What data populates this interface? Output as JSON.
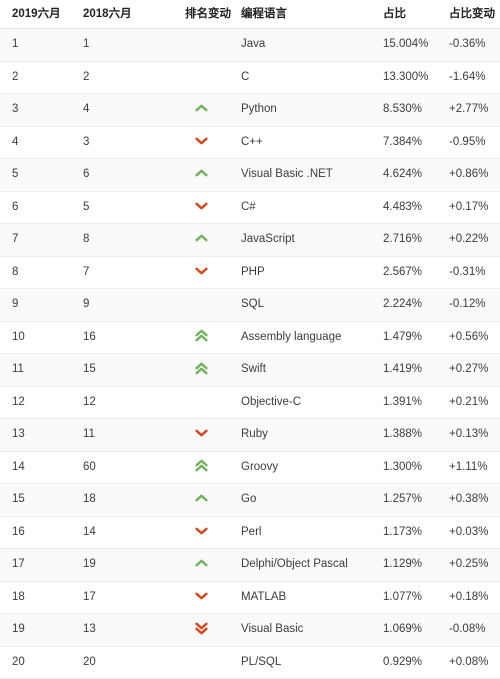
{
  "table": {
    "headers": {
      "rank_new": "2019六月",
      "rank_old": "2018六月",
      "change": "排名变动",
      "language": "编程语言",
      "share": "占比",
      "share_change": "占比变动"
    },
    "colors": {
      "up": "#72b25e",
      "down": "#d8461c",
      "text": "#3c3c3c",
      "header_text": "#222222",
      "row_odd": "#fafafa",
      "row_even": "#ffffff",
      "row_border": "#ededed",
      "header_border": "#e2e2e2"
    },
    "rows": [
      {
        "rank_new": "1",
        "rank_old": "1",
        "trend": "none",
        "language": "Java",
        "share": "15.004%",
        "share_change": "-0.36%"
      },
      {
        "rank_new": "2",
        "rank_old": "2",
        "trend": "none",
        "language": "C",
        "share": "13.300%",
        "share_change": "-1.64%"
      },
      {
        "rank_new": "3",
        "rank_old": "4",
        "trend": "up",
        "language": "Python",
        "share": "8.530%",
        "share_change": "+2.77%"
      },
      {
        "rank_new": "4",
        "rank_old": "3",
        "trend": "down",
        "language": "C++",
        "share": "7.384%",
        "share_change": "-0.95%"
      },
      {
        "rank_new": "5",
        "rank_old": "6",
        "trend": "up",
        "language": "Visual Basic .NET",
        "share": "4.624%",
        "share_change": "+0.86%"
      },
      {
        "rank_new": "6",
        "rank_old": "5",
        "trend": "down",
        "language": "C#",
        "share": "4.483%",
        "share_change": "+0.17%"
      },
      {
        "rank_new": "7",
        "rank_old": "8",
        "trend": "up",
        "language": "JavaScript",
        "share": "2.716%",
        "share_change": "+0.22%"
      },
      {
        "rank_new": "8",
        "rank_old": "7",
        "trend": "down",
        "language": "PHP",
        "share": "2.567%",
        "share_change": "-0.31%"
      },
      {
        "rank_new": "9",
        "rank_old": "9",
        "trend": "none",
        "language": "SQL",
        "share": "2.224%",
        "share_change": "-0.12%"
      },
      {
        "rank_new": "10",
        "rank_old": "16",
        "trend": "up-double",
        "language": "Assembly language",
        "share": "1.479%",
        "share_change": "+0.56%"
      },
      {
        "rank_new": "11",
        "rank_old": "15",
        "trend": "up-double",
        "language": "Swift",
        "share": "1.419%",
        "share_change": "+0.27%"
      },
      {
        "rank_new": "12",
        "rank_old": "12",
        "trend": "none",
        "language": "Objective-C",
        "share": "1.391%",
        "share_change": "+0.21%"
      },
      {
        "rank_new": "13",
        "rank_old": "11",
        "trend": "down",
        "language": "Ruby",
        "share": "1.388%",
        "share_change": "+0.13%"
      },
      {
        "rank_new": "14",
        "rank_old": "60",
        "trend": "up-double",
        "language": "Groovy",
        "share": "1.300%",
        "share_change": "+1.11%"
      },
      {
        "rank_new": "15",
        "rank_old": "18",
        "trend": "up",
        "language": "Go",
        "share": "1.257%",
        "share_change": "+0.38%"
      },
      {
        "rank_new": "16",
        "rank_old": "14",
        "trend": "down",
        "language": "Perl",
        "share": "1.173%",
        "share_change": "+0.03%"
      },
      {
        "rank_new": "17",
        "rank_old": "19",
        "trend": "up",
        "language": "Delphi/Object Pascal",
        "share": "1.129%",
        "share_change": "+0.25%"
      },
      {
        "rank_new": "18",
        "rank_old": "17",
        "trend": "down",
        "language": "MATLAB",
        "share": "1.077%",
        "share_change": "+0.18%"
      },
      {
        "rank_new": "19",
        "rank_old": "13",
        "trend": "down-double",
        "language": "Visual Basic",
        "share": "1.069%",
        "share_change": "-0.08%"
      },
      {
        "rank_new": "20",
        "rank_old": "20",
        "trend": "none",
        "language": "PL/SQL",
        "share": "0.929%",
        "share_change": "+0.08%"
      }
    ]
  }
}
